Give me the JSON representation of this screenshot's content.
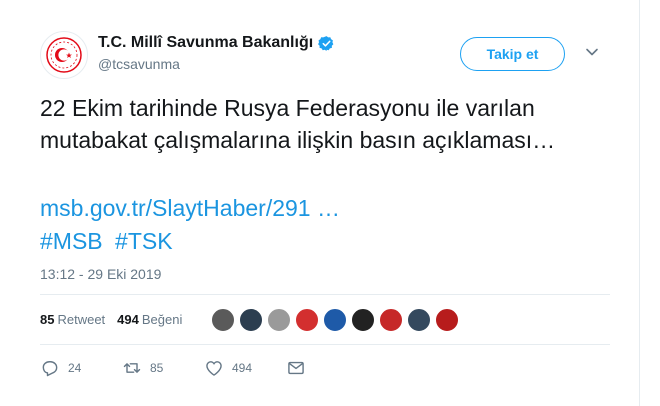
{
  "author": {
    "display_name": "T.C. Millî Savunma Bakanlığı",
    "handle": "@tcsavunma",
    "verified": true,
    "avatar_icon": "crescent-star-emblem-icon",
    "avatar_color": "#e30a17"
  },
  "follow_button": {
    "label": "Takip et"
  },
  "tweet": {
    "text": "22 Ekim tarihinde Rusya Federasyonu ile varılan mutabakat çalışmalarına ilişkin basın açıklaması…",
    "link": "msb.gov.tr/SlaytHaber/291 …",
    "hashtags": [
      "#MSB",
      "#TSK"
    ],
    "timestamp": "13:12 - 29 Eki 2019"
  },
  "stats": {
    "retweets_count": "85",
    "retweets_label": "Retweet",
    "likes_count": "494",
    "likes_label": "Beğeni"
  },
  "likers": [
    {
      "color": "#5a5a5a"
    },
    {
      "color": "#2c3e50"
    },
    {
      "color": "#9a9a9a"
    },
    {
      "color": "#d32f2f"
    },
    {
      "color": "#1e5aa8"
    },
    {
      "color": "#222222"
    },
    {
      "color": "#c62828"
    },
    {
      "color": "#34495e"
    },
    {
      "color": "#b71c1c"
    }
  ],
  "actions": {
    "reply_count": "24",
    "retweet_count": "85",
    "like_count": "494"
  },
  "colors": {
    "accent": "#1da1f2",
    "link": "#1b95e0",
    "muted": "#657786"
  }
}
